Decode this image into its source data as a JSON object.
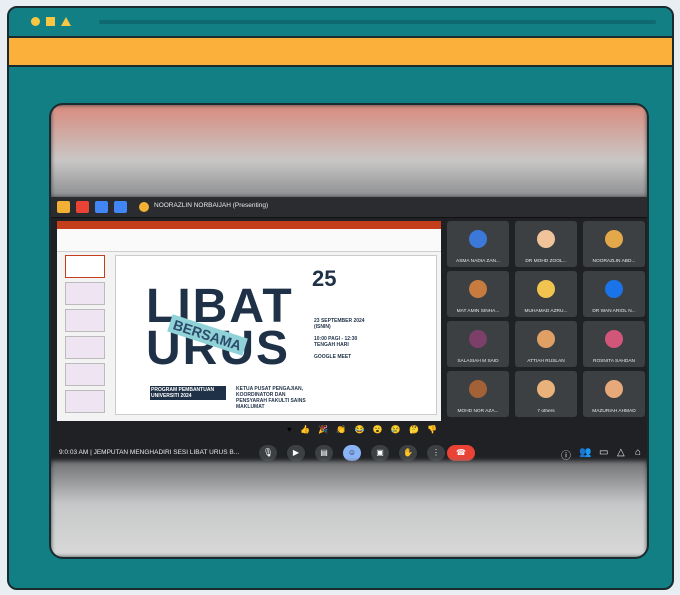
{
  "meet": {
    "presenting_label": "NOORAZLIN NORBAIJAH (Presenting)",
    "time_and_title": "9:0:03 AM  |  JEMPUTAN MENGHADIRI SESI LIBAT URUS B...",
    "reactions": "♥ 👍 🎉 👏 😂 😮 😢 🤔 👎"
  },
  "slide": {
    "line1": "LIBAT",
    "line2": "URUS",
    "bersama": "BERSAMA",
    "program": "PROGRAM PEMBANTUAN UNIVERSITI 2024",
    "ketua": "KETUA PUSAT PENGAJIAN, KOORDINATOR DAN PENSYARAH FAKULTI SAINS MAKLUMAT",
    "number": "25",
    "date": "23 SEPTEMBER 2024 (ISNIN)",
    "time": "10:00 PAGI - 12:30 TENGAH HARI",
    "venue": "GOOGLE MEET"
  },
  "participants": [
    {
      "name": "ASMA NADIA ZAN...",
      "color": "#3b78d8"
    },
    {
      "name": "DR MOHD ZOOL...",
      "color": "#f0c39a"
    },
    {
      "name": "NOORAZLIN ABD...",
      "color": "#e2a84a"
    },
    {
      "name": "MAT AMIN SINHA...",
      "color": "#c77b3e"
    },
    {
      "name": "MUHAMAD AZRU...",
      "color": "#f1c44f"
    },
    {
      "name": "DR WAN ARIOL N...",
      "color": "#1a73e8"
    },
    {
      "name": "SALASIAH M SAID",
      "color": "#7b3f6a"
    },
    {
      "name": "ATTIAH RUSLAN",
      "color": "#e0a065"
    },
    {
      "name": "ROSNITA SAHDAN",
      "color": "#d2557a"
    },
    {
      "name": "MOHD NOR AZA...",
      "color": "#a36138"
    },
    {
      "name": "7 others",
      "color": "#e8b27a"
    },
    {
      "name": "MAZURIAH AHMAD",
      "color": "#e7a97a"
    }
  ]
}
